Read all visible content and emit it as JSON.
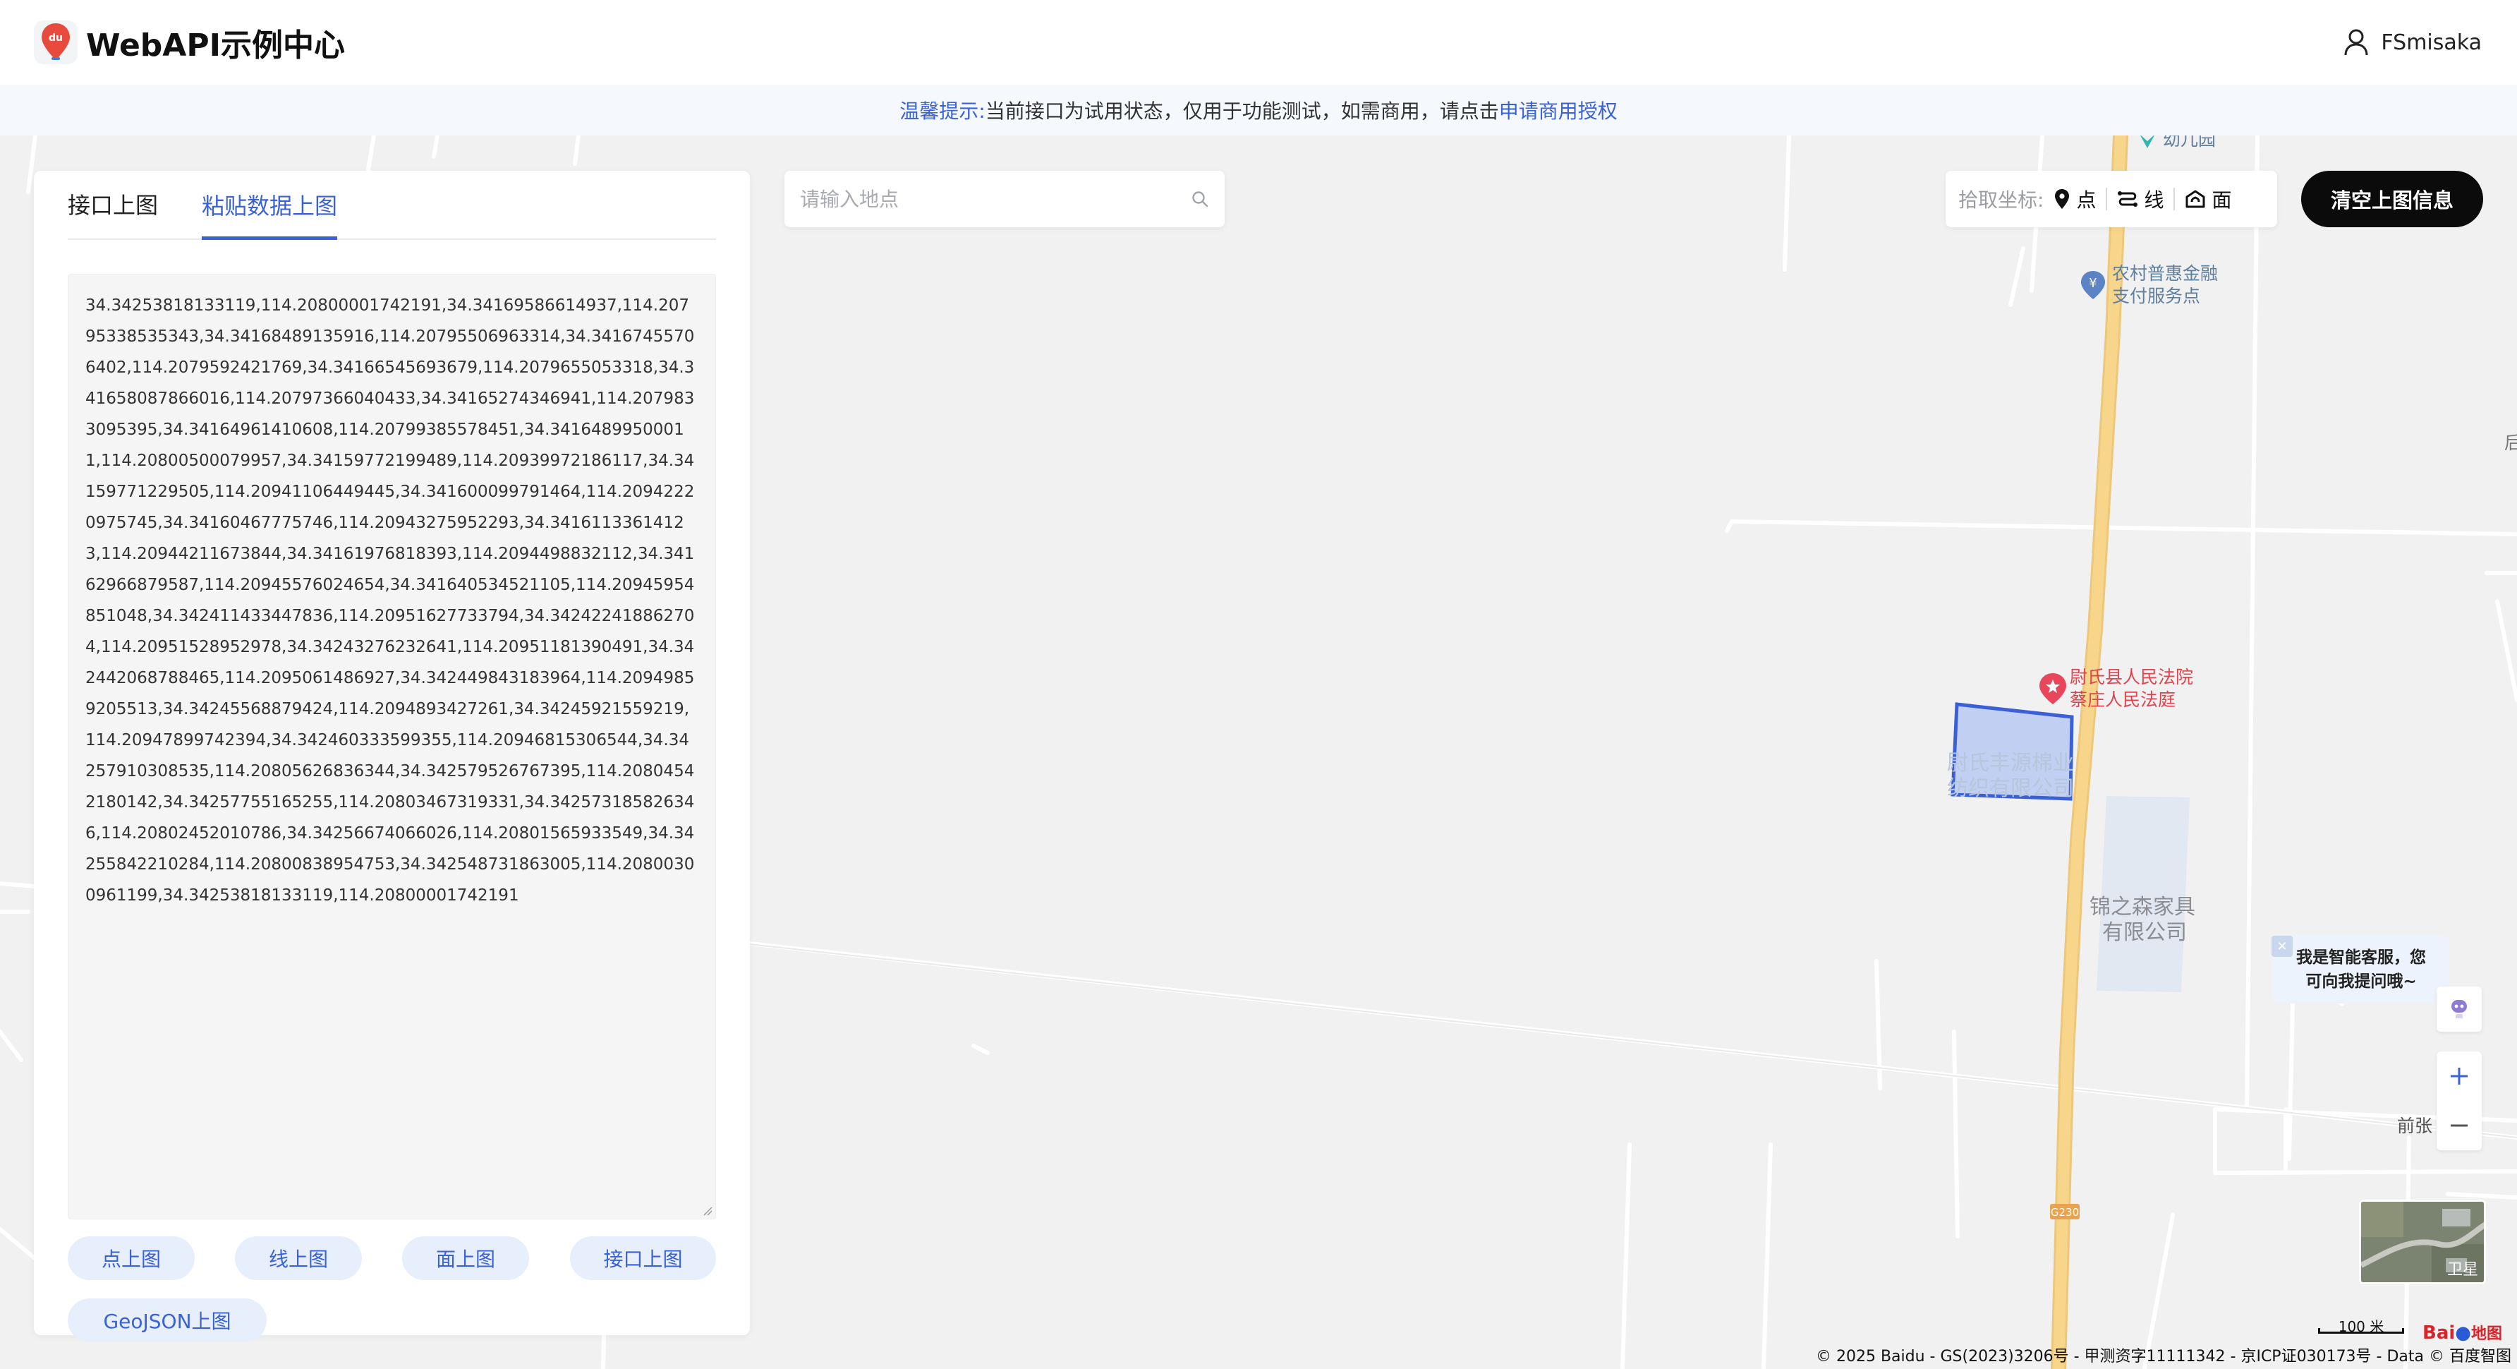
{
  "header": {
    "title": "WebAPI示例中心",
    "logo_text": "du",
    "user_name": "FSmisaka"
  },
  "notice": {
    "label": "温馨提示:",
    "text": "当前接口为试用状态，仅用于功能测试，如需商用，请点击",
    "link": "申请商用授权"
  },
  "panel": {
    "tabs": [
      "接口上图",
      "粘贴数据上图"
    ],
    "active_tab": "粘贴数据上图",
    "data_text": "34.34253818133119,114.20800001742191,34.34169586614937,114.20795338535343,34.34168489135916,114.20795506963314,34.34167455706402,114.2079592421769,34.34166545693679,114.2079655053318,34.341658087866016,114.20797366040433,34.34165274346941,114.2079833095395,34.34164961410608,114.20799385578451,34.34164899500011,114.20800500079957,34.34159772199489,114.20939972186117,34.34159771229505,114.20941106449445,34.341600099791464,114.20942220975745,34.34160467775746,114.20943275952293,34.34161133614123,114.20944211673844,34.34161976818393,114.2094498832112,34.34162966879587,114.20945576024654,34.341640534521105,114.20945954851048,34.342411433447836,114.20951627733794,34.342422418862704,114.20951528952978,34.34243276232641,114.20951181390491,34.342442068788465,114.2095061486927,34.342449843183964,114.20949859205513,34.34245568879424,114.2094893427261,34.34245921559219,114.20947899742394,34.342460333599355,114.20946815306544,34.34257910308535,114.20805626836344,34.342579526767395,114.20804542180142,34.34257755165255,114.20803467319331,34.342573185826346,114.20802452010786,34.34256674066026,114.20801565933549,34.34255842210284,114.20800838954753,34.342548731863005,114.20800300961199,34.34253818133119,114.20800001742191",
    "buttons": [
      "点上图",
      "线上图",
      "面上图",
      "接口上图",
      "GeoJSON上图"
    ]
  },
  "search": {
    "placeholder": "请输入地点",
    "icon": "search-icon"
  },
  "picker": {
    "label": "拾取坐标:",
    "point": "点",
    "line": "线",
    "polygon": "面"
  },
  "clear_button": "清空上图信息",
  "customer_service": {
    "line1": "我是智能客服，您",
    "line2": "可向我提问哦~"
  },
  "map": {
    "pois": {
      "kindergarten": "幼儿园",
      "bank_l1": "农村普惠金融",
      "bank_l2": "支付服务点",
      "court_l1": "尉氏县人民法院",
      "court_l2": "蔡庄人民法庭",
      "company1_l1": "尉氏丰源棉业",
      "company1_l2": "纺织有限公司",
      "company2_l1": "锦之森家具",
      "company2_l2": "有限公司",
      "qianzhang": "前张",
      "edge_char": "后",
      "road": "G230"
    },
    "satellite_label": "卫星",
    "scale": "100 米",
    "copyright": "© 2025 Baidu - GS(2023)3206号 - 甲测资字11111342 - 京ICP证030173号 - Data © 百度智图",
    "baidu_logo": "Bai",
    "baidu_logo_suffix": "地图",
    "colors": {
      "accent": "#3a62d8",
      "highway": "#f7d68c",
      "court_pin": "#e8465a",
      "polygon_fill": "#b8c9f2",
      "polygon_stroke": "#3b5fd6"
    }
  }
}
